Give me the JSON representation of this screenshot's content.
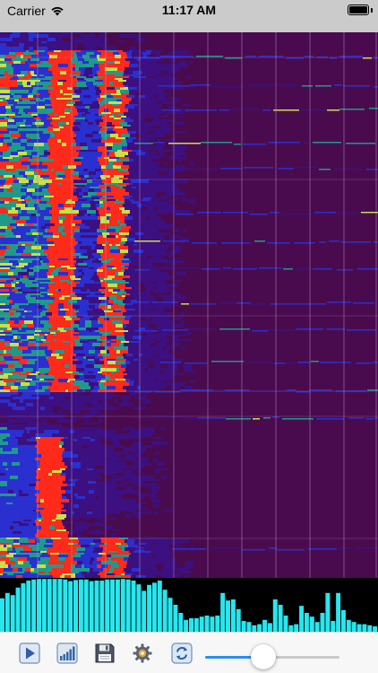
{
  "status_bar": {
    "carrier": "Carrier",
    "time": "11:17 AM",
    "battery_level": 1.0
  },
  "spectrogram": {
    "background_color": "#4a0b4e",
    "grid_color": "#b68bc0",
    "palette": [
      "#4a0b4e",
      "#3c1080",
      "#2a2fd0",
      "#1f9a8a",
      "#c8e04a",
      "#ff2a1a"
    ]
  },
  "level_meter": {
    "bar_color": "#29e6ee",
    "levels": [
      0.62,
      0.72,
      0.68,
      0.82,
      0.9,
      0.95,
      0.97,
      0.98,
      0.98,
      0.98,
      0.98,
      0.98,
      0.97,
      0.94,
      0.96,
      0.97,
      0.97,
      0.94,
      0.95,
      0.95,
      0.97,
      0.97,
      0.97,
      0.98,
      0.97,
      0.95,
      0.88,
      0.76,
      0.87,
      0.91,
      0.95,
      0.78,
      0.63,
      0.5,
      0.35,
      0.22,
      0.25,
      0.25,
      0.28,
      0.3,
      0.28,
      0.3,
      0.72,
      0.58,
      0.6,
      0.42,
      0.2,
      0.18,
      0.12,
      0.14,
      0.22,
      0.16,
      0.6,
      0.5,
      0.3,
      0.12,
      0.14,
      0.48,
      0.35,
      0.28,
      0.18,
      0.35,
      0.72,
      0.2,
      0.72,
      0.4,
      0.22,
      0.18,
      0.14,
      0.14,
      0.12,
      0.1
    ]
  },
  "toolbar": {
    "buttons": [
      {
        "name": "play",
        "icon": "play-icon"
      },
      {
        "name": "levels",
        "icon": "signal-bars-icon"
      },
      {
        "name": "save",
        "icon": "floppy-disk-icon"
      },
      {
        "name": "settings",
        "icon": "gear-icon"
      },
      {
        "name": "refresh",
        "icon": "refresh-icon"
      }
    ],
    "slider_value": 0.43,
    "accent_color": "#2b8cf0"
  }
}
